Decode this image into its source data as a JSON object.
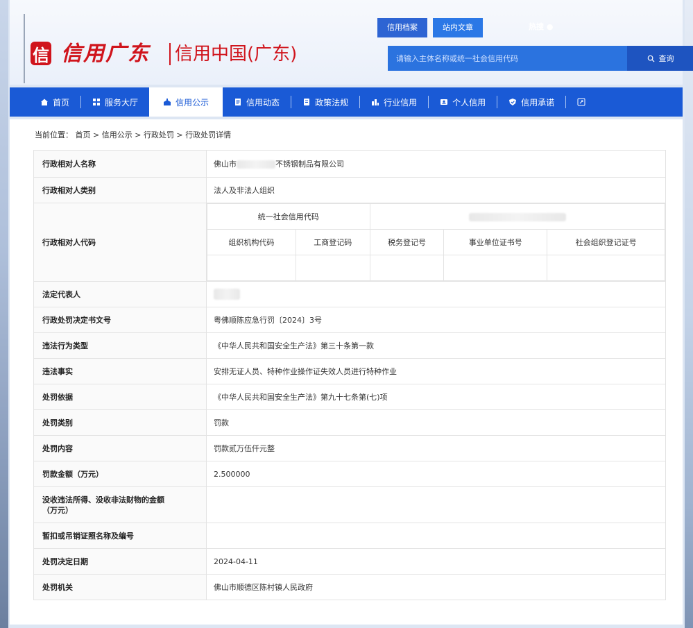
{
  "header": {
    "logo_mark": "信",
    "logo_script": "信用广东",
    "logo_cn": "信用中国(广东)",
    "top_tabs": [
      "信用档案",
      "站内文章"
    ],
    "hot_search": "热搜",
    "search": {
      "placeholder": "请输入主体名称或统一社会信用代码",
      "button": "查询"
    }
  },
  "nav": {
    "items": [
      "首页",
      "服务大厅",
      "信用公示",
      "信用动态",
      "政策法规",
      "行业信用",
      "个人信用",
      "信用承诺"
    ],
    "active_index": 2
  },
  "breadcrumb": "当前位置： 首页 > 信用公示 > 行政处罚 > 行政处罚详情",
  "detail": {
    "name_label": "行政相对人名称",
    "name_prefix": "佛山市",
    "name_suffix": "不锈钢制品有限公司",
    "category_label": "行政相对人类别",
    "category_value": "法人及非法人组织",
    "code_label": "行政相对人代码",
    "code_headers": {
      "usc": "统一社会信用代码",
      "org": "组织机构代码",
      "biz": "工商登记码",
      "tax": "税务登记号",
      "inst": "事业单位证书号",
      "soc": "社会组织登记证号"
    },
    "rep_label": "法定代表人",
    "rows": [
      {
        "label": "行政处罚决定书文号",
        "value": "粤佛顺陈应急行罚〔2024〕3号"
      },
      {
        "label": "违法行为类型",
        "value": "《中华人民共和国安全生产法》第三十条第一款"
      },
      {
        "label": "违法事实",
        "value": "安排无证人员、特种作业操作证失效人员进行特种作业"
      },
      {
        "label": "处罚依据",
        "value": "《中华人民共和国安全生产法》第九十七条第(七)项"
      },
      {
        "label": "处罚类别",
        "value": "罚款"
      },
      {
        "label": "处罚内容",
        "value": "罚款贰万伍仟元整"
      },
      {
        "label": "罚款金额（万元）",
        "value": "2.500000"
      },
      {
        "label": "没收违法所得、没收非法财物的金额（万元）",
        "value": ""
      },
      {
        "label": "暂扣或吊销证照名称及编号",
        "value": ""
      },
      {
        "label": "处罚决定日期",
        "value": "2024-04-11"
      },
      {
        "label": "处罚机关",
        "value": "佛山市顺德区陈村镇人民政府"
      }
    ]
  }
}
